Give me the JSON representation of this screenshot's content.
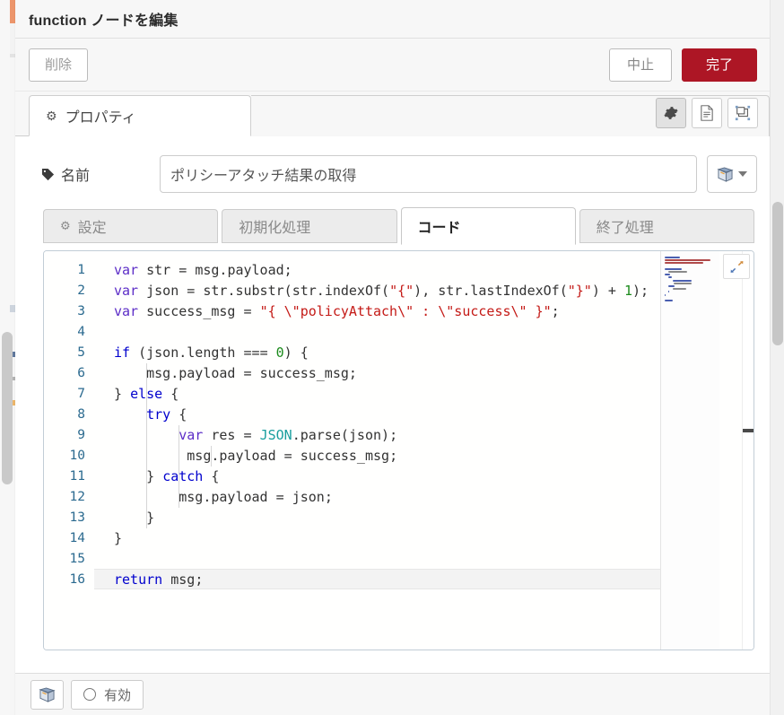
{
  "dialog": {
    "title": "function ノードを編集",
    "delete_label": "削除",
    "cancel_label": "中止",
    "done_label": "完了",
    "done_color": "#ad1625"
  },
  "tabs": {
    "properties_label": "プロパティ",
    "properties_icon": "gear-icon",
    "header_icons": [
      {
        "name": "gear-icon",
        "active": true
      },
      {
        "name": "document-icon",
        "active": false
      },
      {
        "name": "expand-node-icon",
        "active": false
      }
    ]
  },
  "name_row": {
    "label": "名前",
    "label_icon": "tag-icon",
    "value": "ポリシーアタッチ結果の取得",
    "placeholder": "名前",
    "library_button_icon": "book-icon"
  },
  "subtabs": [
    {
      "label": "設定",
      "icon": "gear-icon",
      "active": false
    },
    {
      "label": "初期化処理",
      "icon": "",
      "active": false
    },
    {
      "label": "コード",
      "icon": "",
      "active": true
    },
    {
      "label": "終了処理",
      "icon": "",
      "active": false
    }
  ],
  "editor": {
    "active_line": 16,
    "expand_icon": "expand-diagonal-icon",
    "line_numbers": [
      1,
      2,
      3,
      4,
      5,
      6,
      7,
      8,
      9,
      10,
      11,
      12,
      13,
      14,
      15,
      16
    ],
    "lines": [
      {
        "n": 1,
        "text": "var str = msg.payload;"
      },
      {
        "n": 2,
        "text": "var json = str.substr(str.indexOf(\"{\"), str.lastIndexOf(\"}\") + 1);"
      },
      {
        "n": 3,
        "text": "var success_msg = \"{ \\\"policyAttach\\\" : \\\"success\\\" }\";"
      },
      {
        "n": 4,
        "text": ""
      },
      {
        "n": 5,
        "text": "if (json.length === 0) {"
      },
      {
        "n": 6,
        "text": "    msg.payload = success_msg;"
      },
      {
        "n": 7,
        "text": "} else {"
      },
      {
        "n": 8,
        "text": "    try {"
      },
      {
        "n": 9,
        "text": "        var res = JSON.parse(json);"
      },
      {
        "n": 10,
        "text": "         msg.payload = success_msg;"
      },
      {
        "n": 11,
        "text": "    } catch {"
      },
      {
        "n": 12,
        "text": "        msg.payload = json;"
      },
      {
        "n": 13,
        "text": "    }"
      },
      {
        "n": 14,
        "text": "}"
      },
      {
        "n": 15,
        "text": ""
      },
      {
        "n": 16,
        "text": "return msg;"
      }
    ]
  },
  "footer": {
    "library_icon": "book-icon",
    "enabled_label": "有効",
    "enabled_icon": "circle-icon"
  }
}
